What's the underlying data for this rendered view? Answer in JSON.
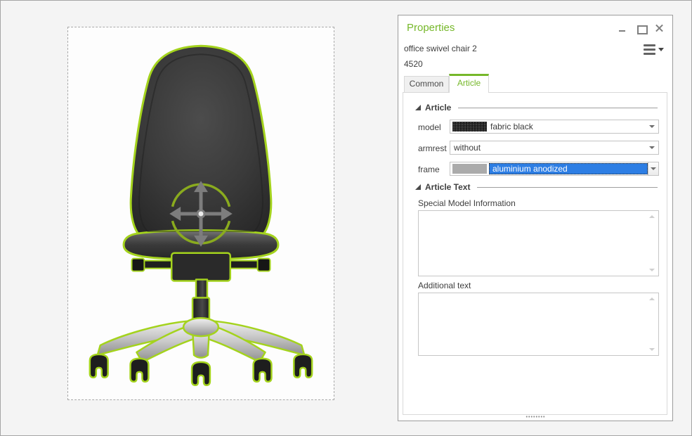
{
  "window": {
    "title": "Properties"
  },
  "header": {
    "object_name": "office swivel chair 2",
    "article_number": "4520"
  },
  "icons": {
    "window_controls": [
      "minimize-icon",
      "maximize-icon",
      "close-icon"
    ],
    "menu": "hamburger-menu-icon",
    "menu_caret": "chevron-down-icon",
    "combo_arrow": "chevron-down-icon",
    "section_expander": "expander-triangle-icon",
    "canvas_gizmo": "move-crosshair-icon"
  },
  "tabs": [
    {
      "label": "Common",
      "active": false
    },
    {
      "label": "Article",
      "active": true
    }
  ],
  "article_section": {
    "title": "Article",
    "fields": [
      {
        "label": "model",
        "value": "fabric black",
        "swatch": "fabric-black-texture"
      },
      {
        "label": "armrest",
        "value": "without"
      },
      {
        "label": "frame",
        "value": "aluminium anodized",
        "swatch": "#ababab",
        "highlighted": true
      }
    ]
  },
  "article_text_section": {
    "title": "Article Text",
    "textareas": [
      {
        "label": "Special Model Information",
        "value": ""
      },
      {
        "label": "Additional text",
        "value": ""
      }
    ]
  },
  "colors": {
    "accent_green": "#76b82a",
    "selection_outline_green": "#a4d31d",
    "gizmo_green": "#8aab1e",
    "highlight_blue": "#2d7ee4",
    "frame_swatch_gray": "#ababab"
  }
}
